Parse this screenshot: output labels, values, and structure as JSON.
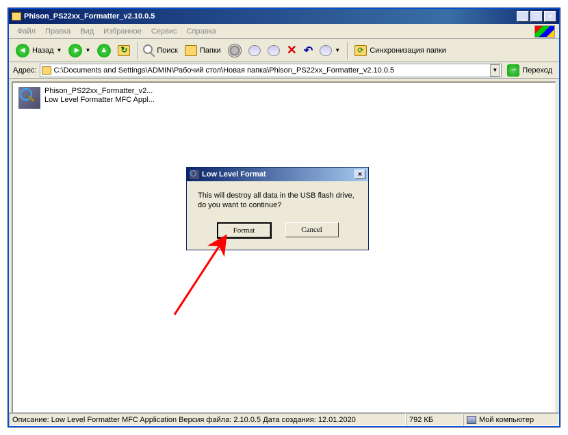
{
  "window": {
    "title": "Phison_PS22xx_Formatter_v2.10.0.5"
  },
  "menu": {
    "file": "Файл",
    "edit": "Правка",
    "view": "Вид",
    "favorites": "Избранное",
    "tools": "Сервис",
    "help": "Справка"
  },
  "toolbar": {
    "back": "Назад",
    "search": "Поиск",
    "folders": "Папки",
    "sync": "Синхронизация папки"
  },
  "address": {
    "label": "Адрес:",
    "path": "C:\\Documents and Settings\\ADMIN\\Рабочий стол\\Новая папка\\Phison_PS22xx_Formatter_v2.10.0.5",
    "go": "Переход"
  },
  "file_item": {
    "name": "Phison_PS22xx_Formatter_v2...",
    "desc": "Low Level Formatter MFC Appl..."
  },
  "dialog": {
    "title": "Low Level Format",
    "message": "This will destroy all data in the USB flash drive, do you want to continue?",
    "format": "Format",
    "cancel": "Cancel"
  },
  "status": {
    "main": "Описание: Low Level Formatter MFC Application Версия файла: 2.10.0.5 Дата создания: 12.01.2020",
    "size": "792 КБ",
    "location": "Мой компьютер"
  }
}
